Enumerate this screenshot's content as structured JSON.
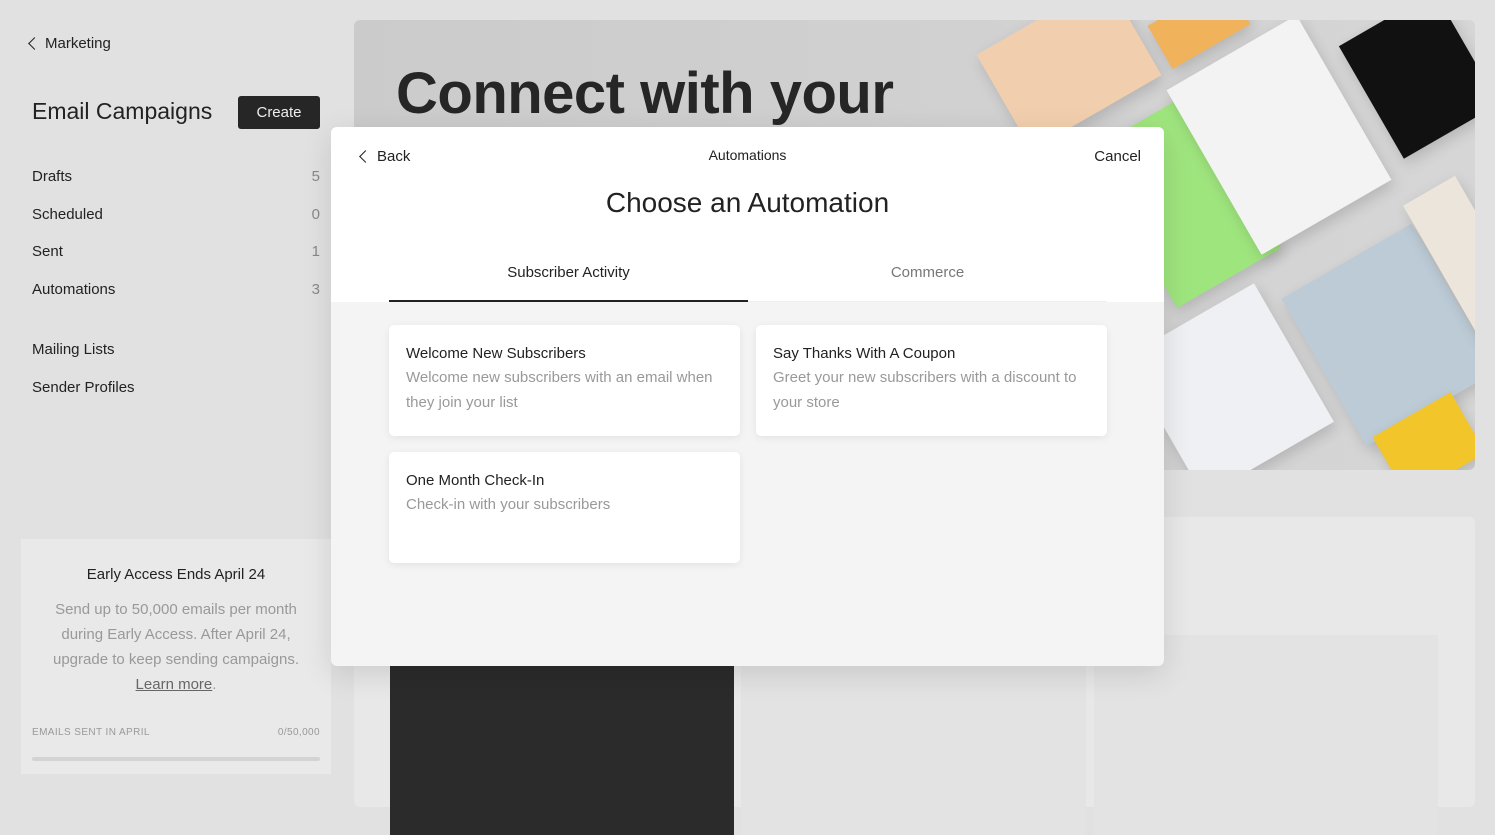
{
  "sidebar": {
    "back_label": "Marketing",
    "title": "Email Campaigns",
    "create_label": "Create",
    "items": [
      {
        "label": "Drafts",
        "count": "5"
      },
      {
        "label": "Scheduled",
        "count": "0"
      },
      {
        "label": "Sent",
        "count": "1"
      },
      {
        "label": "Automations",
        "count": "3"
      }
    ],
    "links": [
      {
        "label": "Mailing Lists"
      },
      {
        "label": "Sender Profiles"
      }
    ],
    "promo": {
      "title": "Early Access Ends April 24",
      "body": "Send up to 50,000 emails per month during Early Access. After April 24, upgrade to keep sending campaigns.",
      "link": "Learn more",
      "period": ".",
      "meter_label": "EMAILS SENT IN APRIL",
      "meter_value": "0/50,000",
      "meter_fraction": 0
    }
  },
  "hero": {
    "headline": "Connect with your"
  },
  "modal": {
    "back_label": "Back",
    "title": "Automations",
    "cancel_label": "Cancel",
    "heading": "Choose an Automation",
    "tabs": [
      {
        "label": "Subscriber Activity",
        "active": true
      },
      {
        "label": "Commerce",
        "active": false
      }
    ],
    "cards": [
      {
        "title": "Welcome New Subscribers",
        "desc": "Welcome new subscribers with an email when they join your list"
      },
      {
        "title": "Say Thanks With A Coupon",
        "desc": "Greet your new subscribers with a discount to your store"
      },
      {
        "title": "One Month Check-In",
        "desc": "Check-in with your subscribers"
      }
    ]
  }
}
